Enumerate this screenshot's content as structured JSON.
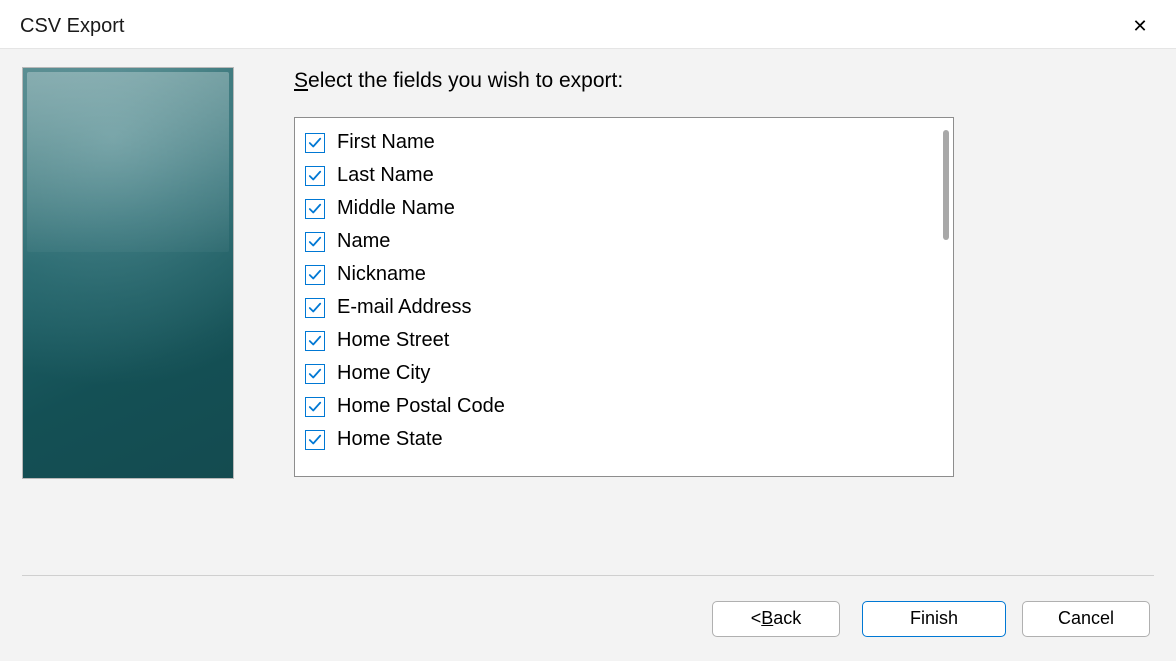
{
  "title": "CSV Export",
  "instruction_prefix": "S",
  "instruction_rest": "elect the fields you wish to export:",
  "fields": [
    {
      "label": "First Name",
      "checked": true
    },
    {
      "label": "Last Name",
      "checked": true
    },
    {
      "label": "Middle Name",
      "checked": true
    },
    {
      "label": "Name",
      "checked": true
    },
    {
      "label": "Nickname",
      "checked": true
    },
    {
      "label": "E-mail Address",
      "checked": true
    },
    {
      "label": "Home Street",
      "checked": true
    },
    {
      "label": "Home City",
      "checked": true
    },
    {
      "label": "Home Postal Code",
      "checked": true
    },
    {
      "label": "Home State",
      "checked": true
    }
  ],
  "buttons": {
    "back_prefix": "< ",
    "back_u": "B",
    "back_rest": "ack",
    "finish": "Finish",
    "cancel": "Cancel"
  },
  "close_glyph": "✕"
}
